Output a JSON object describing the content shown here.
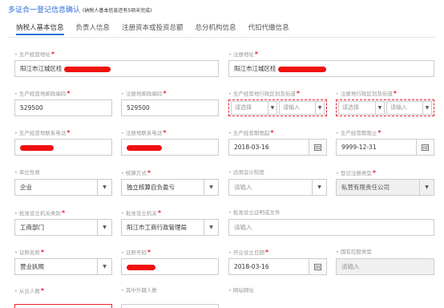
{
  "header": {
    "title": "多证合一登记信息确认",
    "subtitle": "(纳税人基本信息还有5项未完成)"
  },
  "tabs": [
    {
      "label": "纳税人基本信息"
    },
    {
      "label": "负责人信息"
    },
    {
      "label": "注册资本或投资总额"
    },
    {
      "label": "总分机构信息"
    },
    {
      "label": "代扣代缴信息"
    }
  ],
  "fields": {
    "prod_address": {
      "label": "生产经营地址",
      "value": "阳江市江城区桂"
    },
    "reg_address": {
      "label": "注册地址",
      "value": "阳江市江城区桂"
    },
    "prod_postcode": {
      "label": "生产经营地邮政编码",
      "value": "529500"
    },
    "reg_postcode": {
      "label": "注册地邮政编码",
      "value": "529500"
    },
    "prod_district": {
      "label": "生产经营地行政区划及街道",
      "sel1": "请选择",
      "sel2": "请输入"
    },
    "reg_district": {
      "label": "注册地行政区划及街道",
      "sel1": "请选择",
      "sel2": "请输入"
    },
    "prod_phone": {
      "label": "生产经营地联系电话"
    },
    "reg_phone": {
      "label": "注册地联系电话"
    },
    "prod_start": {
      "label": "生产经营期限起",
      "value": "2018-03-16"
    },
    "prod_end": {
      "label": "生产经营期限止",
      "value": "9999-12-31"
    },
    "unit_nature": {
      "label": "单位性质",
      "value": "企业"
    },
    "accounting": {
      "label": "核算方式",
      "value": "独立核算自负盈亏"
    },
    "acct_system": {
      "label": "适用会计制度",
      "placeholder": "请输入"
    },
    "reg_type": {
      "label": "登记注册类型",
      "value": "私营有限责任公司"
    },
    "approve_type": {
      "label": "批准设立机关类别",
      "value": "工商部门"
    },
    "approve_org": {
      "label": "批准设立机关",
      "value": "阳江市工商行政管理局"
    },
    "approve_doc": {
      "label": "批准设立证明或文件",
      "placeholder": "请输入"
    },
    "cert_name": {
      "label": "证照名称",
      "value": "营业执照"
    },
    "cert_no": {
      "label": "证照号码"
    },
    "open_date": {
      "label": "开业设立日期",
      "value": "2018-03-16"
    },
    "industry": {
      "label": "国有控股类型",
      "placeholder": "请输入"
    },
    "employees": {
      "label": "从业人数"
    },
    "foreign_count": {
      "label": "其中外籍人数"
    },
    "website": {
      "label": "网站网址"
    }
  }
}
